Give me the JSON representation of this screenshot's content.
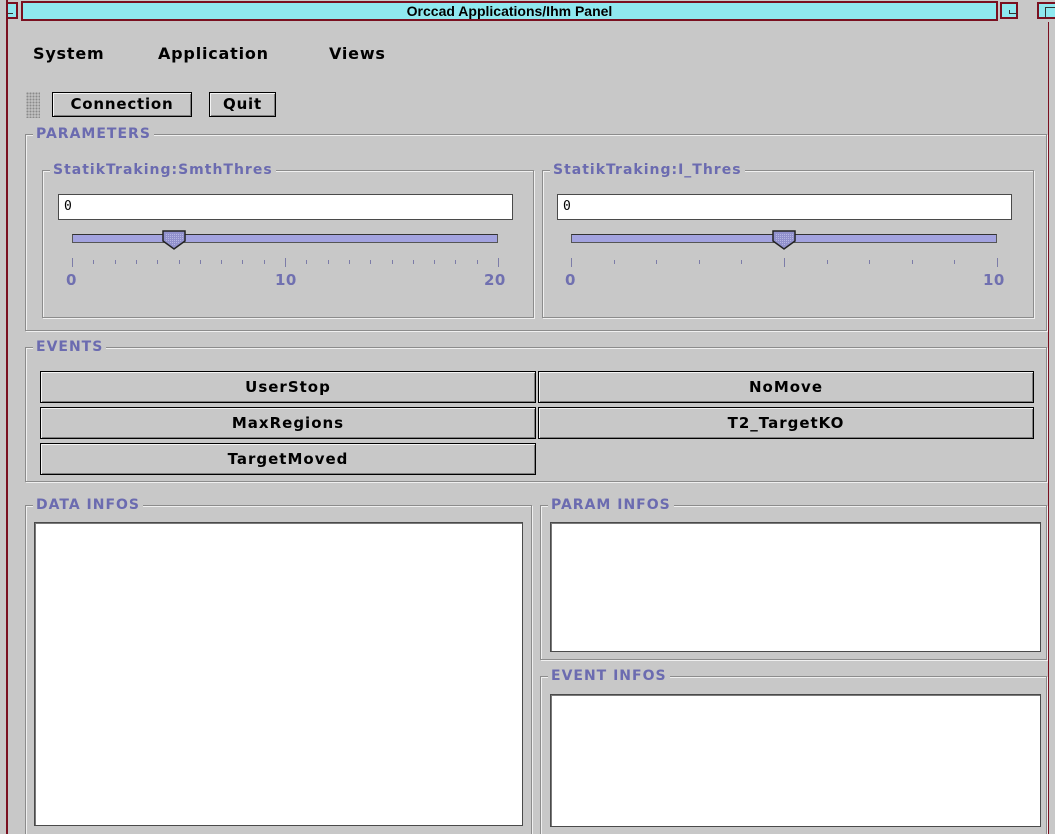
{
  "window": {
    "title": "Orccad Applications/Ihm Panel"
  },
  "menubar": {
    "items": [
      "System",
      "Application",
      "Views"
    ]
  },
  "toolbar": {
    "connection_label": "Connection",
    "quit_label": "Quit"
  },
  "parameters": {
    "label": "PARAMETERS",
    "sliders": [
      {
        "label": "StatikTraking:SmthThres",
        "value": "0",
        "min_label": "0",
        "mid_label": "10",
        "max_label": "20",
        "min": 0,
        "max": 20,
        "thumb_value": 5
      },
      {
        "label": "StatikTraking:I_Thres",
        "value": "0",
        "min_label": "0",
        "max_label": "10",
        "min": 0,
        "max": 10,
        "thumb_value": 5
      }
    ]
  },
  "events": {
    "label": "EVENTS",
    "buttons": [
      "UserStop",
      "NoMove",
      "MaxRegions",
      "T2_TargetKO",
      "TargetMoved"
    ]
  },
  "data_infos": {
    "label": "DATA INFOS"
  },
  "param_infos": {
    "label": "PARAM INFOS"
  },
  "event_infos": {
    "label": "EVENT INFOS"
  },
  "colors": {
    "title_bg": "#8fe8ef",
    "frame": "#7a1020",
    "group_label": "#6b6bb0",
    "slider_track": "#a3a3df",
    "panel_bg": "#c8c8c8"
  }
}
